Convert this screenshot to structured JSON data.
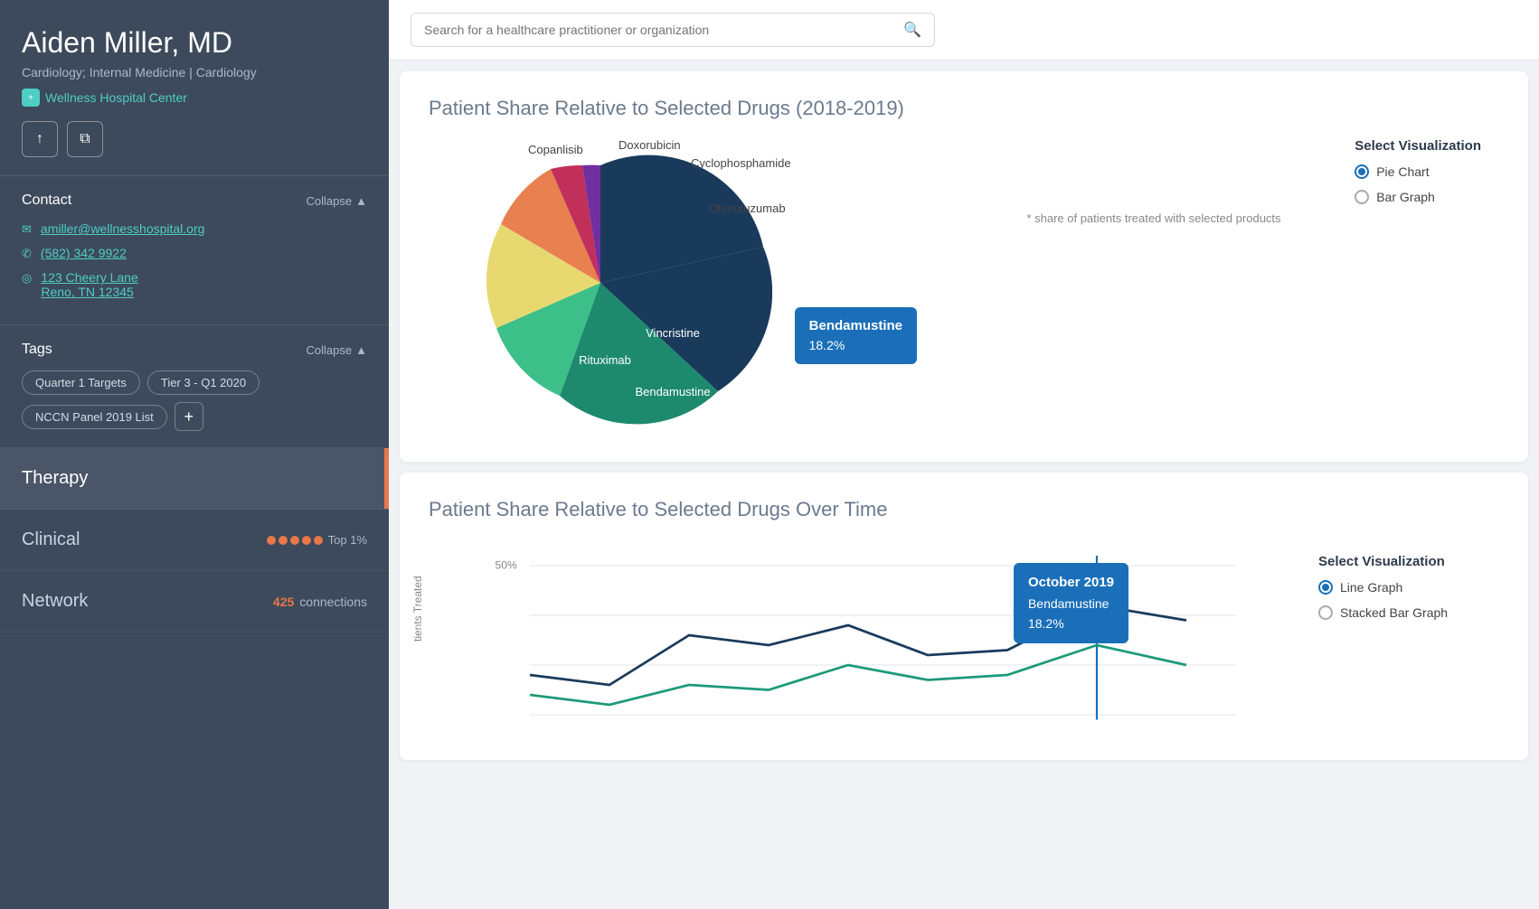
{
  "sidebar": {
    "doctor_name": "Aiden Miller, MD",
    "specialty": "Cardiology; Internal Medicine | Cardiology",
    "hospital": "Wellness Hospital Center",
    "actions": {
      "upload_label": "↑",
      "copy_label": "⧉"
    },
    "contact": {
      "section_title": "Contact",
      "collapse_label": "Collapse",
      "email": "amiller@wellnesshospital.org",
      "phone": "(582) 342 9922",
      "address_line1": "123 Cheery Lane",
      "address_line2": "Reno, TN 12345"
    },
    "tags": {
      "section_title": "Tags",
      "collapse_label": "Collapse",
      "items": [
        "Quarter 1 Targets",
        "Tier 3 - Q1 2020",
        "NCCN Panel 2019 List"
      ],
      "add_label": "+"
    },
    "nav": [
      {
        "label": "Therapy",
        "active": true,
        "meta": ""
      },
      {
        "label": "Clinical",
        "active": false,
        "meta": "dots",
        "badge": "Top 1%"
      },
      {
        "label": "Network",
        "active": false,
        "meta": "connections",
        "count": "425",
        "connections_label": "connections"
      }
    ]
  },
  "search": {
    "placeholder": "Search for a healthcare practitioner or organization"
  },
  "pie_chart": {
    "title": "Patient Share Relative to Selected Drugs",
    "year_range": "(2018-2019)",
    "footnote": "* share of patients treated with selected products",
    "segments": [
      {
        "name": "Rituximab",
        "value": 38,
        "color": "#1a3a5c"
      },
      {
        "name": "Bendamustine",
        "value": 18.2,
        "color": "#1d8a6e"
      },
      {
        "name": "Vincristine",
        "value": 14,
        "color": "#3dbf8a"
      },
      {
        "name": "Obinutuzumab",
        "value": 10,
        "color": "#e8d870"
      },
      {
        "name": "Cyclophosphamide",
        "value": 8,
        "color": "#e88050"
      },
      {
        "name": "Doxorubicin",
        "value": 6,
        "color": "#c0305a"
      },
      {
        "name": "Copanlisib",
        "value": 5.8,
        "color": "#7030a0"
      }
    ],
    "tooltip": {
      "label": "Bendamustine",
      "value": "18.2%"
    },
    "viz_options": {
      "title": "Select Visualization",
      "options": [
        "Pie Chart",
        "Bar Graph"
      ],
      "selected": "Pie Chart"
    }
  },
  "line_chart": {
    "title": "Patient Share Relative to Selected Drugs Over Time",
    "y_label": "tients Treated",
    "y_max": "50%",
    "tooltip": {
      "month": "October 2019",
      "drug": "Bendamustine",
      "value": "18.2%"
    },
    "viz_options": {
      "title": "Select Visualization",
      "options": [
        "Line Graph",
        "Stacked Bar Graph"
      ],
      "selected": "Line Graph"
    }
  }
}
